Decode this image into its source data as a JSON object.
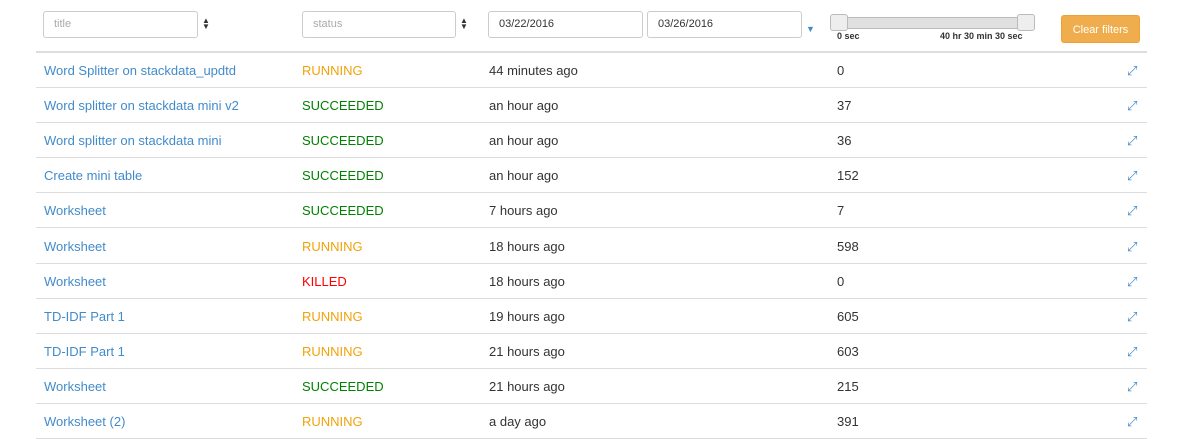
{
  "filters": {
    "title_placeholder": "title",
    "status_placeholder": "status",
    "date_from": "03/22/2016",
    "date_to": "03/26/2016",
    "slider_min_label": "0 sec",
    "slider_max_label": "40 hr 30 min 30 sec",
    "clear_label": "Clear filters"
  },
  "colors": {
    "RUNNING": "#f0a30a",
    "SUCCEEDED": "#008000",
    "KILLED": "#ff0000"
  },
  "rows": [
    {
      "title": "Word Splitter on stackdata_updtd",
      "status": "RUNNING",
      "time": "44 minutes ago",
      "count": "0"
    },
    {
      "title": "Word splitter on stackdata mini v2",
      "status": "SUCCEEDED",
      "time": "an hour ago",
      "count": "37"
    },
    {
      "title": "Word splitter on stackdata mini",
      "status": "SUCCEEDED",
      "time": "an hour ago",
      "count": "36"
    },
    {
      "title": "Create mini table",
      "status": "SUCCEEDED",
      "time": "an hour ago",
      "count": "152"
    },
    {
      "title": "Worksheet",
      "status": "SUCCEEDED",
      "time": "7 hours ago",
      "count": "7"
    },
    {
      "title": "Worksheet",
      "status": "RUNNING",
      "time": "18 hours ago",
      "count": "598"
    },
    {
      "title": "Worksheet",
      "status": "KILLED",
      "time": "18 hours ago",
      "count": "0"
    },
    {
      "title": "TD-IDF Part 1",
      "status": "RUNNING",
      "time": "19 hours ago",
      "count": "605"
    },
    {
      "title": "TD-IDF Part 1",
      "status": "RUNNING",
      "time": "21 hours ago",
      "count": "603"
    },
    {
      "title": "Worksheet",
      "status": "SUCCEEDED",
      "time": "21 hours ago",
      "count": "215"
    },
    {
      "title": "Worksheet (2)",
      "status": "RUNNING",
      "time": "a day ago",
      "count": "391"
    }
  ]
}
